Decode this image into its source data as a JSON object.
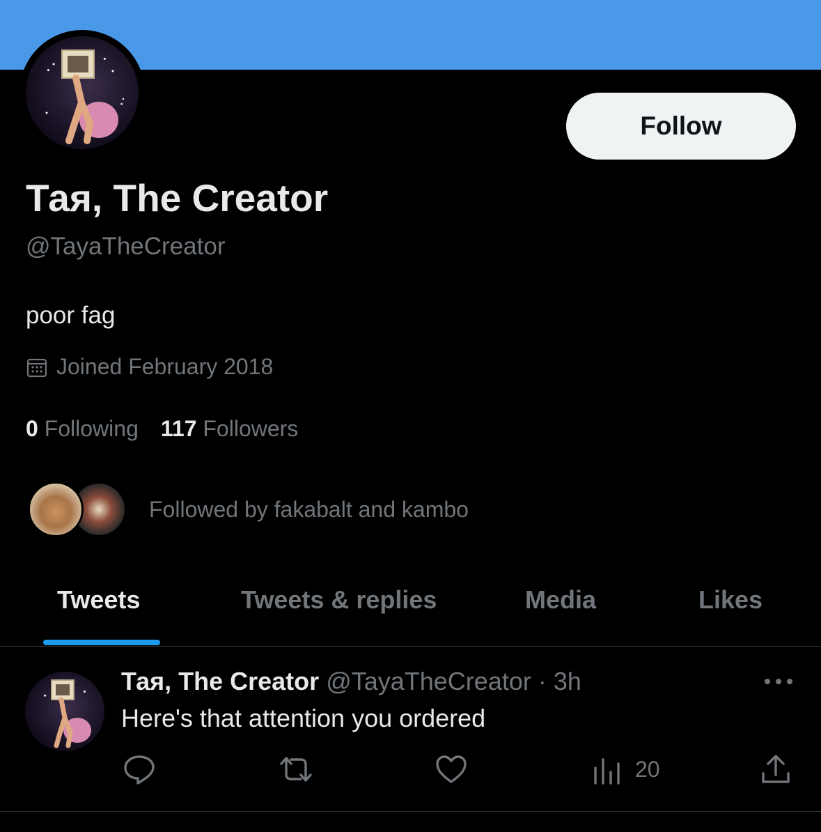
{
  "profile": {
    "display_name": "Тая, The Creator",
    "handle": "@TayaTheCreator",
    "bio": "poor fag",
    "joined": "Joined February 2018",
    "follow_label": "Follow",
    "following_count": "0",
    "following_label": "Following",
    "followers_count": "117",
    "followers_label": "Followers",
    "followed_by": "Followed by fakabalt and kambo"
  },
  "tabs": [
    {
      "label": "Tweets",
      "active": true
    },
    {
      "label": "Tweets & replies",
      "active": false
    },
    {
      "label": "Media",
      "active": false
    },
    {
      "label": "Likes",
      "active": false
    }
  ],
  "tweet": {
    "author_name": "Тая, The Creator",
    "author_handle": "@TayaTheCreator",
    "separator": "·",
    "time": "3h",
    "text": "Here's that attention you ordered",
    "views": "20"
  },
  "icons": [
    "calendar-icon",
    "reply-icon",
    "retweet-icon",
    "like-icon",
    "views-icon",
    "share-icon",
    "more-icon"
  ],
  "colors": {
    "banner": "#4a99e9",
    "accent": "#1d9bf0",
    "background": "#000000",
    "muted_text": "#71767b"
  }
}
